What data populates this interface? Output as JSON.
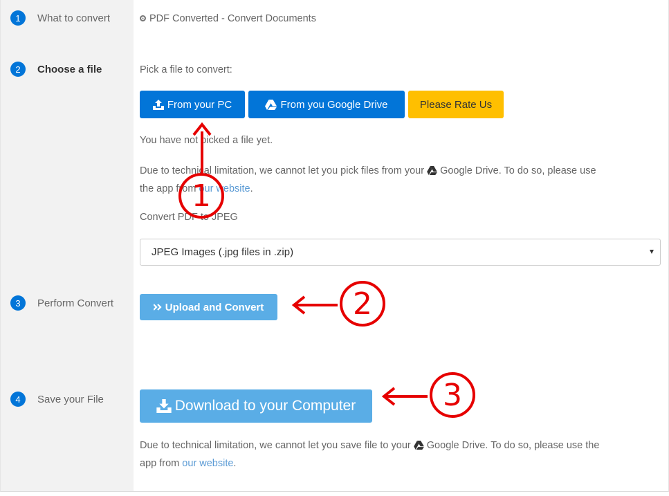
{
  "steps": [
    {
      "number": "1",
      "label": "What to convert"
    },
    {
      "number": "2",
      "label": "Choose a file"
    },
    {
      "number": "3",
      "label": "Perform Convert"
    },
    {
      "number": "4",
      "label": "Save your File"
    }
  ],
  "convert_option": "PDF Converted - Convert Documents",
  "choose": {
    "prompt": "Pick a file to convert:",
    "btn_pc": "From your PC",
    "btn_drive": "From you Google Drive",
    "btn_rate": "Please Rate Us",
    "status": "You have not picked a file yet.",
    "limitation_pre": "Due to technical limitation, we cannot let you pick files from your",
    "limitation_mid": "Google Drive. To do so, please use",
    "limitation_line2_pre": "the app from",
    "link": "our website",
    "limitation_end": ".",
    "convert_label": "Convert PDF to JPEG",
    "select_value": "JPEG Images (.jpg files in .zip)"
  },
  "perform": {
    "btn_upload": "Upload and Convert"
  },
  "save": {
    "btn_download": "Download to your Computer",
    "limitation_pre": "Due to technical limitation, we cannot let you save file to your",
    "limitation_mid": "Google Drive. To do so, please use the",
    "limitation_line2_pre": "app from",
    "link": "our website",
    "limitation_end": "."
  },
  "annotations": {
    "one": "1",
    "two": "2",
    "three": "3"
  },
  "colors": {
    "primary": "#0275d8",
    "warning": "#ffbf00",
    "light_primary": "#5aade6",
    "annotation": "#e60000"
  }
}
